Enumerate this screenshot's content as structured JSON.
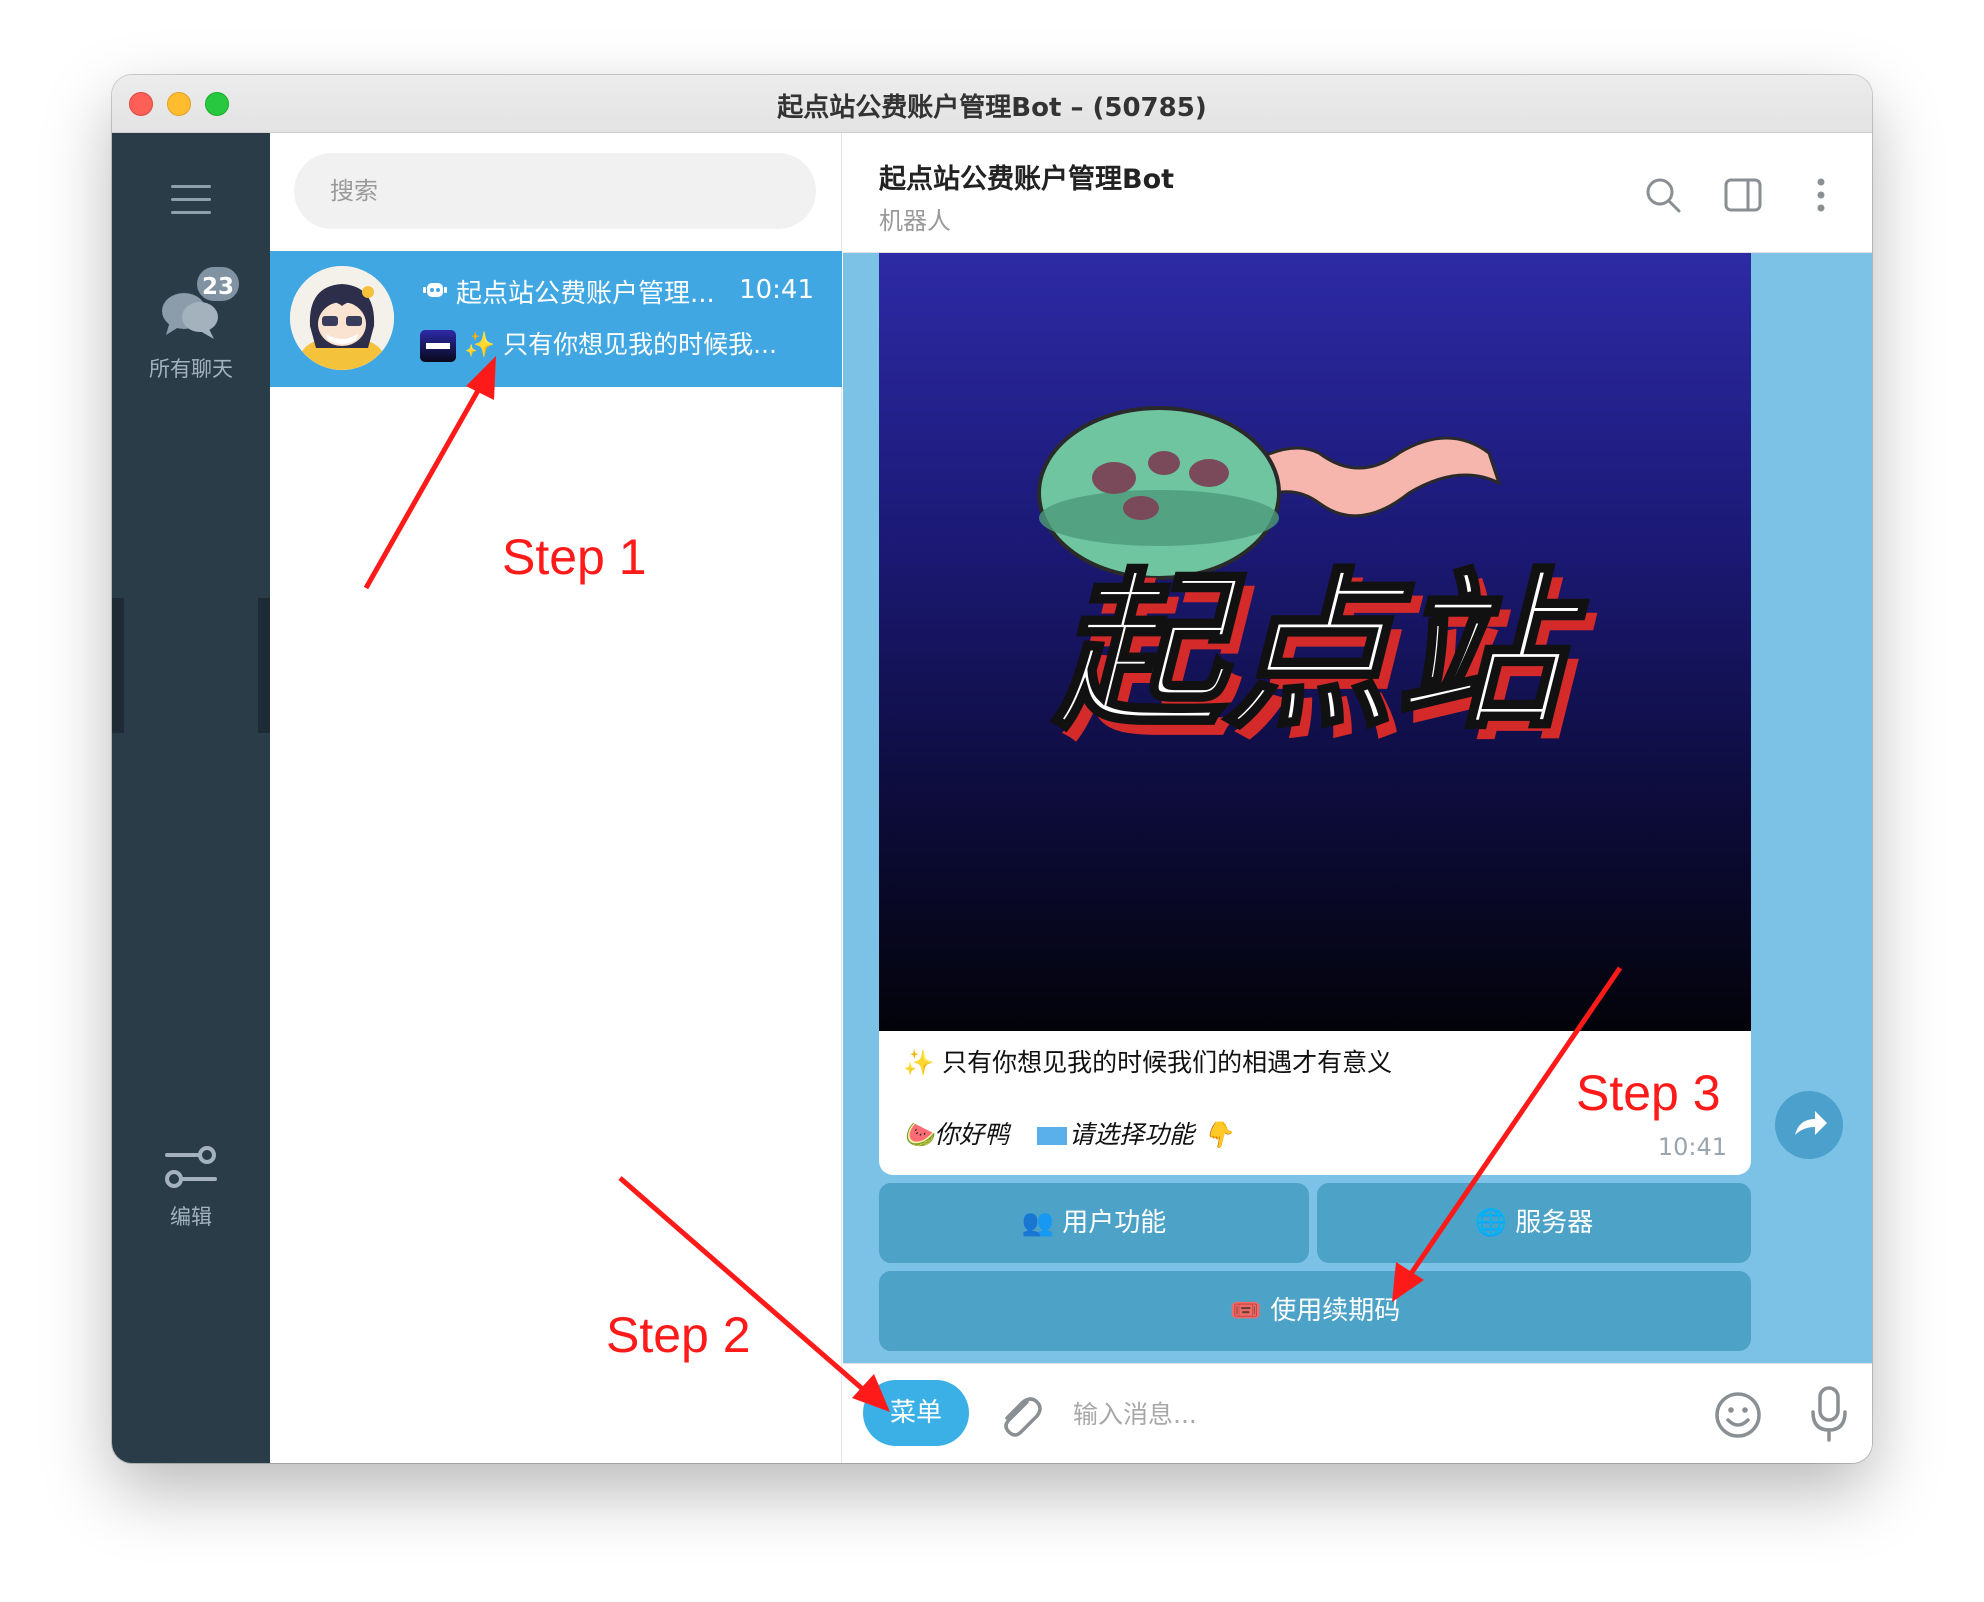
{
  "window": {
    "title": "起点站公费账户管理Bot – (50785)"
  },
  "sidebar": {
    "all_chats_label": "所有聊天",
    "unread_count": "23",
    "edit_label": "编辑"
  },
  "chat_list": {
    "search_placeholder": "搜索",
    "items": [
      {
        "name": "起点站公费账户管理...",
        "time": "10:41",
        "preview": "✨ 只有你想见我的时候我..."
      }
    ]
  },
  "chat": {
    "title": "起点站公费账户管理Bot",
    "subtitle": "机器人",
    "image_caption_text": "起点站",
    "message_line1": "✨ 只有你想见我的时候我们的相遇才有意义",
    "message_line2_a": "🍉你好鸭",
    "message_line2_b": "请选择功能 👇",
    "message_time": "10:41",
    "keyboard": {
      "btn_user": "👥 用户功能",
      "btn_server": "🌐 服务器",
      "btn_renew": "🎟️ 使用续期码"
    }
  },
  "composer": {
    "menu_label": "菜单",
    "placeholder": "输入消息..."
  },
  "annotations": {
    "step1": "Step 1",
    "step2": "Step 2",
    "step3": "Step 3",
    "color": "#ff1a1a"
  },
  "colors": {
    "rail": "#2b3c49",
    "selected_chat": "#40a7e3",
    "chat_background": "#7cc2e6",
    "keyboard_button": "#4da2c7",
    "menu_button": "#3bb0e6"
  }
}
